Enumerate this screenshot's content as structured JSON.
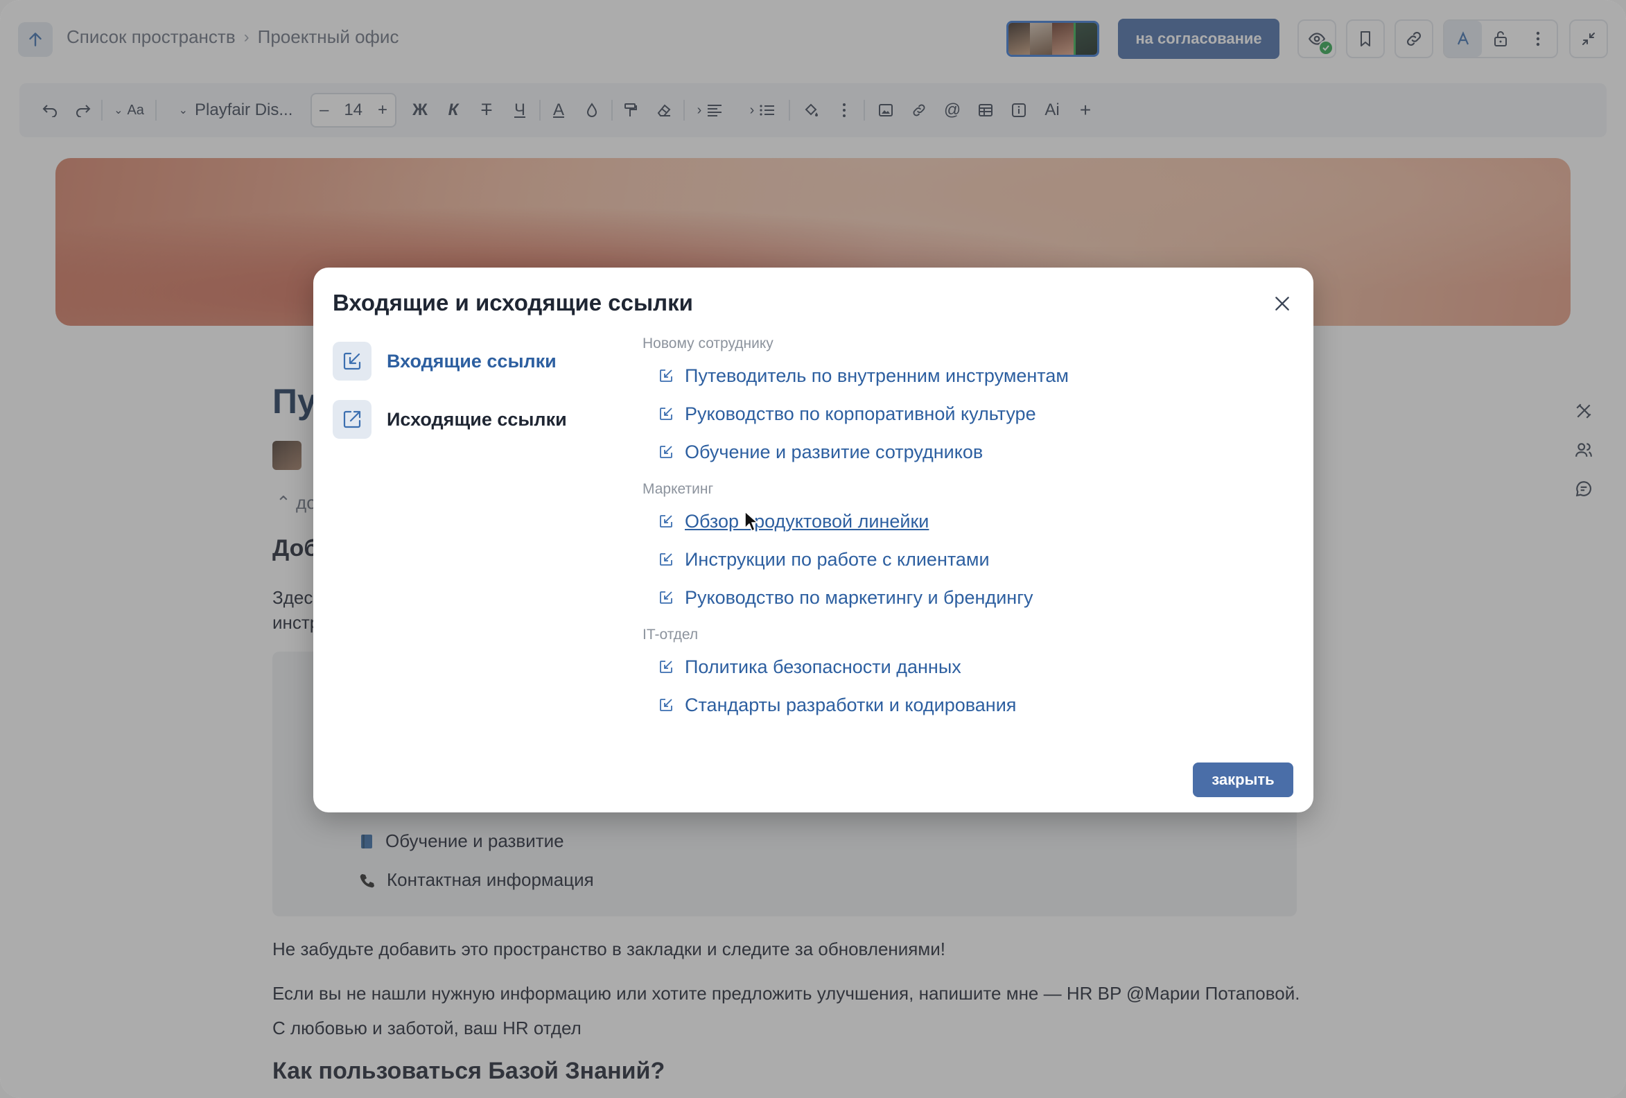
{
  "topbar": {
    "breadcrumb": [
      "Список пространств",
      "Проектный офис"
    ],
    "breadcrumb_separator": "›",
    "approve_label": "на согласование",
    "icons": [
      "arrow-up-icon",
      "eye-icon",
      "bookmark-icon",
      "link-icon",
      "text-style-icon",
      "lock-icon",
      "more-vertical-icon",
      "collapse-icon"
    ]
  },
  "toolbar": {
    "font_name": "Playfair Dis...",
    "font_size": "14",
    "minus": "–",
    "plus": "+",
    "bold": "Ж",
    "italic": "К",
    "strike": "Т",
    "underline": "Ч",
    "text_color": "A",
    "ai_label": "Ai",
    "at_sign": "@",
    "add": "+",
    "size_toggle": "Aa"
  },
  "document": {
    "title_fragment": "Пу",
    "collapse_fragment": "до",
    "heading_fragment": "Доб",
    "para_fragment_1": "Здес",
    "para_fragment_2": "инстр",
    "callout_items": [
      {
        "icon": "book-icon",
        "label": "Обучение и развитие"
      },
      {
        "icon": "phone-icon",
        "label": "Контактная информация"
      }
    ],
    "line_1": "Не забудьте добавить это пространство в закладки и следите за обновлениями!",
    "line_2": "Если вы не нашли нужную информацию или хотите предложить улучшения, напишите мне — HR BP @Марии Потаповой.",
    "line_3": "С любовью и заботой, ваш HR отдел",
    "heading_2": "Как пользоваться Базой Знаний?"
  },
  "modal": {
    "title": "Входящие и исходящие ссылки",
    "nav": [
      {
        "label": "Входящие ссылки",
        "icon": "incoming-link-icon",
        "active": true
      },
      {
        "label": "Исходящие ссылки",
        "icon": "outgoing-link-icon",
        "active": false
      }
    ],
    "groups": [
      {
        "label": "Новому сотруднику",
        "links": [
          "Путеводитель по внутренним инструментам",
          "Руководство по корпоративной культуре",
          "Обучение и развитие сотрудников"
        ]
      },
      {
        "label": "Маркетинг",
        "links": [
          "Обзор продуктовой линейки",
          "Инструкции по работе с клиентами",
          "Руководство по маркетингу и брендингу"
        ]
      },
      {
        "label": "IT-отдел",
        "links": [
          "Политика безопасности данных",
          "Стандарты разработки и кодирования"
        ]
      }
    ],
    "close_button": "закрыть"
  },
  "colors": {
    "accent": "#4a6ea8",
    "link": "#2d5fa0",
    "overlay": "rgba(70,70,70,0.45)",
    "success": "#2fa84f"
  }
}
